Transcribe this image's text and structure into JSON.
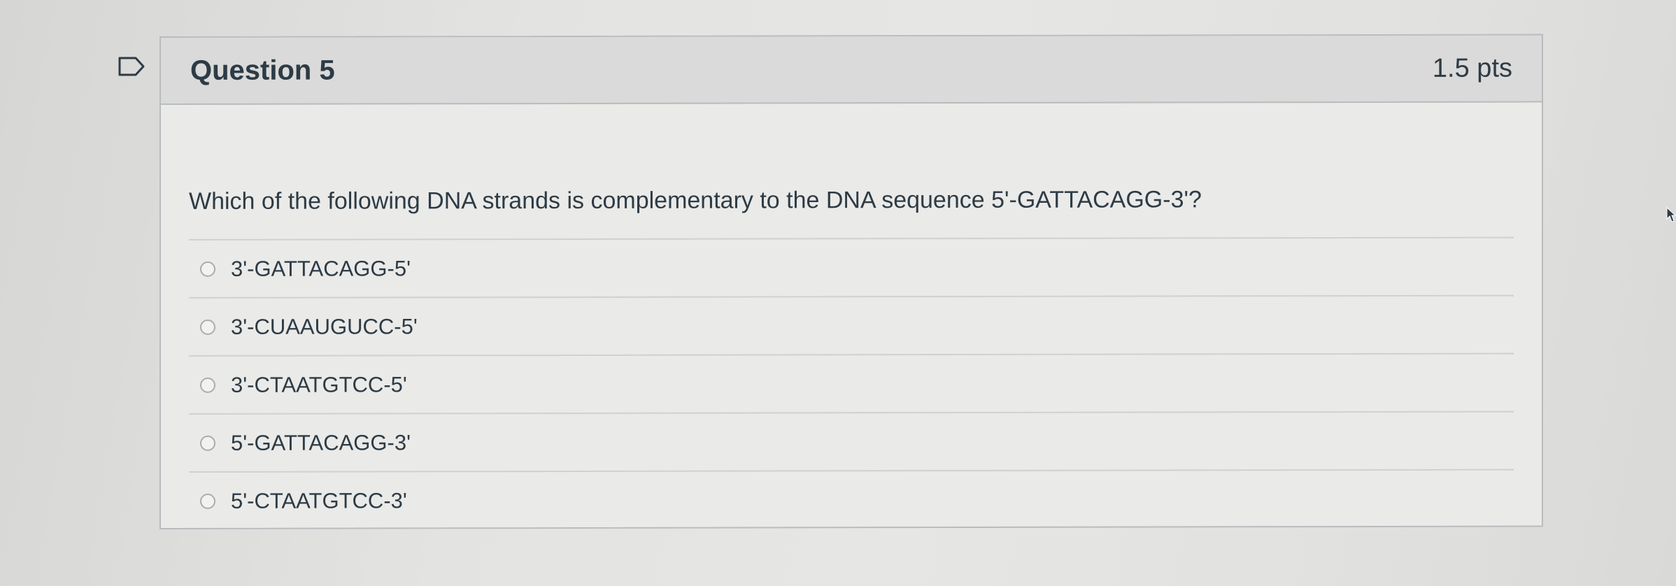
{
  "question": {
    "title": "Question 5",
    "points": "1.5 pts",
    "text": "Which of the following DNA strands is complementary to the DNA sequence 5'-GATTACAGG-3'?"
  },
  "answers": [
    {
      "label": "3'-GATTACAGG-5'"
    },
    {
      "label": "3'-CUAAUGUCC-5'"
    },
    {
      "label": "3'-CTAATGTCC-5'"
    },
    {
      "label": "5'-GATTACAGG-3'"
    },
    {
      "label": "5'-CTAATGTCC-3'"
    }
  ],
  "icons": {
    "flag": "flag-icon",
    "radio": "radio-unselected-icon",
    "cursor": "mouse-pointer-icon"
  },
  "colors": {
    "text": "#2d3b45",
    "header_bg": "#d9dad9",
    "border": "#b9bcbe"
  }
}
